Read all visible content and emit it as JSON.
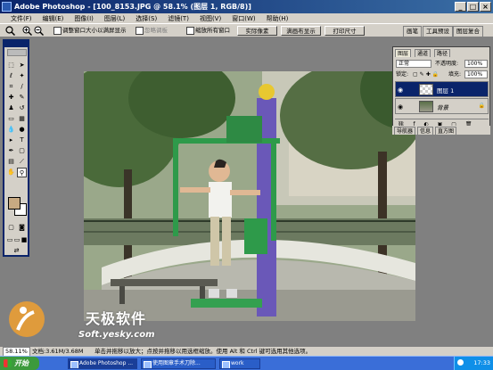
{
  "window": {
    "title": "Adobe Photoshop - [100_8153.JPG @ 58.1% (图层 1, RGB/8)]",
    "controls": [
      "_",
      "□",
      "×"
    ]
  },
  "menu": [
    "文件(F)",
    "编辑(E)",
    "图像(I)",
    "图层(L)",
    "选择(S)",
    "滤镜(T)",
    "视图(V)",
    "窗口(W)",
    "帮助(H)"
  ],
  "options_bar": {
    "tool_icon": "zoom-icon",
    "zoom_in_icon": "zoom-in-icon",
    "zoom_out_icon": "zoom-out-icon",
    "resize_windows_label": "调整窗口大小以满屏显示",
    "ignore_palettes_label": "忽略调板",
    "zoom_all_windows_label": "缩放所有窗口",
    "actual_pixels_label": "实际像素",
    "fit_on_screen_label": "满画布显示",
    "print_size_label": "打印尺寸",
    "palette_tabs": [
      "画笔",
      "工具预设",
      "图层复合"
    ]
  },
  "layers_panel": {
    "tabs": [
      "图层",
      "通道",
      "路径"
    ],
    "blend_mode": "正常",
    "opacity_label": "不透明度:",
    "opacity_value": "100%",
    "lock_label": "锁定:",
    "fill_label": "填充:",
    "fill_value": "100%",
    "layers": [
      {
        "name": "图层 1",
        "selected": true
      },
      {
        "name": "背景",
        "selected": false
      }
    ]
  },
  "navigator_panel": {
    "tabs": [
      "导航器",
      "信息",
      "直方图"
    ]
  },
  "status_bar": {
    "zoom": "58.11%",
    "doc_info": "文档:3.61M/3.68M",
    "hint": "单击并拖移以放大；点按并拖移以用选框缩放。使用 Alt 和 Ctrl 键可选用其他选项。"
  },
  "taskbar": {
    "start_label": "开始",
    "tasks": [
      {
        "label": "Adobe Photoshop ...",
        "active": true
      },
      {
        "label": "使用图章手术刀除...",
        "active": false
      },
      {
        "label": "work",
        "active": false
      }
    ],
    "clock": "17:33"
  },
  "watermark": {
    "cn": "天极软件",
    "en": "Soft.yesky.com"
  },
  "colors": {
    "title_bar": "#0a246a",
    "chrome": "#d4d0c8",
    "foreground_swatch": "#c8aa82",
    "background_swatch": "#ffffff",
    "taskbar": "#3a6ed8"
  }
}
